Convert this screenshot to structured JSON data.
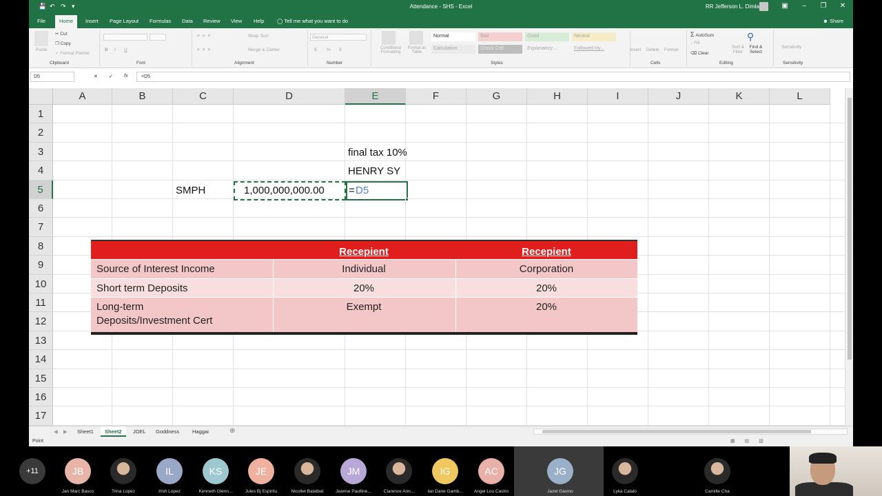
{
  "window": {
    "title": "Attendance - SHS - Excel",
    "user": "RR Jefferson L. Dimla",
    "minimize": "–",
    "restore": "❐",
    "close": "✕",
    "ribbon_display": "▣"
  },
  "quick_access": {
    "save": "💾",
    "undo": "↶",
    "redo": "↷",
    "customize": "▾"
  },
  "ribbon_tabs": [
    "File",
    "Home",
    "Insert",
    "Page Layout",
    "Formulas",
    "Data",
    "Review",
    "View",
    "Help"
  ],
  "tell_me": "Tell me what you want to do",
  "share": "Share",
  "ribbon": {
    "clipboard": {
      "paste": "Paste",
      "cut": "Cut",
      "copy": "Copy",
      "format_painter": "Format Painter",
      "label": "Clipboard"
    },
    "font": {
      "label": "Font",
      "bold": "B",
      "italic": "I",
      "underline": "U"
    },
    "alignment": {
      "wrap_text": "Wrap Text",
      "merge_center": "Merge & Center",
      "label": "Alignment"
    },
    "number": {
      "format": "General",
      "label": "Number",
      "currency": "$",
      "percent": "%",
      "comma": "9"
    },
    "styles": {
      "conditional": "Conditional Formatting",
      "format_table": "Format as Table",
      "cells": [
        "Normal",
        "Bad",
        "Good",
        "Neutral",
        "Calculation",
        "Check Cell",
        "Explanatory ...",
        "Followed Hy..."
      ],
      "label": "Styles"
    },
    "cells_group": {
      "insert": "Insert",
      "delete": "Delete",
      "format": "Format",
      "label": "Cells"
    },
    "editing": {
      "autosum": "AutoSum",
      "fill": "Fill",
      "clear": "Clear",
      "sort_filter": "Sort & Filter",
      "find_select": "Find & Select",
      "label": "Editing"
    },
    "sensitivity": {
      "button": "Sensitivity",
      "label": "Sensitivity"
    }
  },
  "formula_bar": {
    "name_box": "D5",
    "cancel": "✕",
    "enter": "✓",
    "fx": "fx",
    "formula": "=D5"
  },
  "columns": [
    "A",
    "B",
    "C",
    "D",
    "E",
    "F",
    "G",
    "H",
    "I",
    "J",
    "K",
    "L"
  ],
  "rows": [
    "1",
    "2",
    "3",
    "4",
    "5",
    "6",
    "7",
    "8",
    "9",
    "10",
    "11",
    "12",
    "13",
    "14",
    "15",
    "16",
    "17"
  ],
  "cells": {
    "E3": "final tax 10%",
    "E4": "HENRY SY",
    "C5": "SMPH",
    "D5": "1,000,000,000.00",
    "E5_eq": "=",
    "E5_ref": "D5"
  },
  "pasted_table": {
    "header": [
      "",
      "Recepient",
      "Recepient"
    ],
    "rows": [
      [
        "Source of Interest Income",
        "Individual",
        "Corporation"
      ],
      [
        "Short term Deposits",
        "20%",
        "20%"
      ],
      [
        "Long-term Deposits/Investment Cert",
        "Exempt",
        "20%"
      ]
    ],
    "long_term_line1": "Long-term",
    "long_term_line2": "Deposits/Investment Cert"
  },
  "sheets": [
    "Sheet1",
    "Sheet2",
    "JOEL",
    "Goddness",
    "Haggai"
  ],
  "active_sheet": "Sheet2",
  "add_sheet": "⊕",
  "status": {
    "mode": "Point"
  },
  "meeting": {
    "more_count": "+11",
    "participants": [
      {
        "initials": "JB",
        "name": "Jan Marc Basco",
        "color": "#e8b4a8"
      },
      {
        "initials": "",
        "name": "Trina Lopez",
        "color": "#444"
      },
      {
        "initials": "IL",
        "name": "Irish Lopez",
        "color": "#9aa8c8"
      },
      {
        "initials": "KS",
        "name": "Kenneth Glenn...",
        "color": "#9ec8d0"
      },
      {
        "initials": "JE",
        "name": "Jules Bj Espiritu",
        "color": "#f0b0a0"
      },
      {
        "initials": "",
        "name": "Nicollet Balatbat",
        "color": "#555"
      },
      {
        "initials": "JM",
        "name": "Jeanne Paulline...",
        "color": "#b8a8d8"
      },
      {
        "initials": "",
        "name": "Clarence Ann...",
        "color": "#444"
      },
      {
        "initials": "IG",
        "name": "Ian Dane Gamb...",
        "color": "#f0c860"
      },
      {
        "initials": "AC",
        "name": "Angel Lou Castro",
        "color": "#e8b0a8"
      },
      {
        "initials": "JG",
        "name": "Jazel Gavino",
        "color": "#9ab0c8"
      },
      {
        "initials": "",
        "name": "Lyka Calalo",
        "color": "#444"
      },
      {
        "initials": "",
        "name": "Camille Cha",
        "color": "#444"
      }
    ]
  }
}
